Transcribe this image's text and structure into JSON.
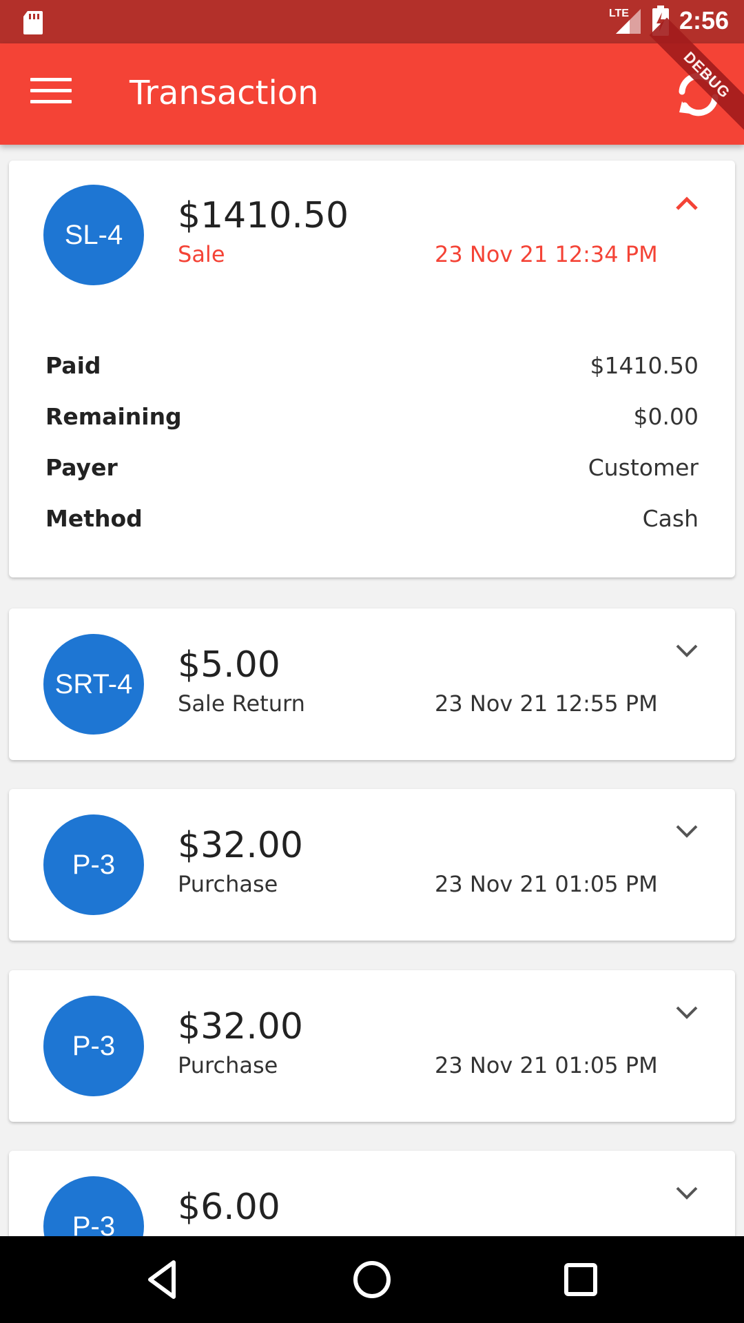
{
  "status_bar": {
    "time": "2:56",
    "network": "LTE"
  },
  "app_bar": {
    "title": "Transaction",
    "debug_label": "DEBUG"
  },
  "transactions": [
    {
      "code": "SL-4",
      "amount": "$1410.50",
      "type": "Sale",
      "date": "23 Nov 21 12:34 PM",
      "expanded": true,
      "details": [
        {
          "label": "Paid",
          "value": "$1410.50"
        },
        {
          "label": "Remaining",
          "value": "$0.00"
        },
        {
          "label": "Payer",
          "value": "Customer"
        },
        {
          "label": "Method",
          "value": "Cash"
        }
      ]
    },
    {
      "code": "SRT-4",
      "amount": "$5.00",
      "type": "Sale Return",
      "date": "23 Nov 21 12:55 PM",
      "expanded": false
    },
    {
      "code": "P-3",
      "amount": "$32.00",
      "type": "Purchase",
      "date": "23 Nov 21 01:05 PM",
      "expanded": false
    },
    {
      "code": "P-3",
      "amount": "$32.00",
      "type": "Purchase",
      "date": "23 Nov 21 01:05 PM",
      "expanded": false
    },
    {
      "code": "P-3",
      "amount": "$6.00",
      "type": "",
      "date": "",
      "expanded": false
    }
  ],
  "colors": {
    "primary": "#f44336",
    "status_bar": "#b3302a",
    "avatar": "#1e76d3",
    "accent_text": "#f44336"
  },
  "icons": {
    "menu": "hamburger-menu-icon",
    "refresh": "refresh-icon",
    "expand": "chevron-down-icon",
    "collapse": "chevron-up-icon",
    "back": "back-triangle-icon",
    "home": "home-circle-icon",
    "recents": "recents-square-icon"
  }
}
